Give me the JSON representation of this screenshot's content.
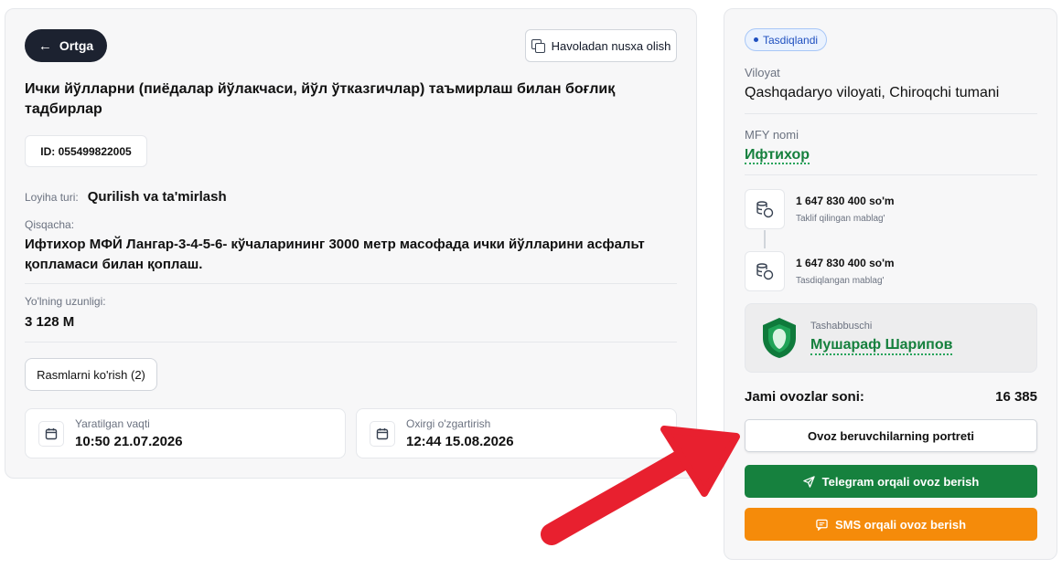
{
  "header": {
    "back_label": "Ortga",
    "copy_label": "Havoladan nusxa olish"
  },
  "project": {
    "title": "Ички йўлларни (пиёдалар йўлакчаси, йўл ўтказгичлар) таъмирлаш билан боғлиқ тадбирлар",
    "id": "ID: 055499822005",
    "type_label": "Loyiha turi:",
    "type_value": "Qurilish va ta'mirlash",
    "summary_label": "Qisqacha:",
    "summary_text": "Ифтихор МФЙ Лангар-3-4-5-6- кўчаларининг 3000 метр масофада ички йўлларини асфальт қопламаси билан қоплаш.",
    "length_label": "Yo'lning uzunligi:",
    "length_value": "3 128 М",
    "photos_label": "Rasmlarni ko'rish (2)",
    "created_label": "Yaratilgan vaqti",
    "created_value": "10:50 21.07.2026",
    "modified_label": "Oxirgi o'zgartirish",
    "modified_value": "12:44 15.08.2026"
  },
  "side": {
    "status": "Tasdiqlandi",
    "region_label": "Viloyat",
    "region_value": "Qashqadaryo viloyati, Chiroqchi tumani",
    "mfy_label": "MFY nomi",
    "mfy_value": "Ифтихор",
    "proposed_amount": "1 647 830 400 so'm",
    "proposed_label": "Taklif qilingan mablag'",
    "approved_amount": "1 647 830 400 so'm",
    "approved_label": "Tasdiqlangan mablag'",
    "initiator_label": "Tashabbuschi",
    "initiator_name": "Мушараф Шарипов",
    "votes_label": "Jami ovozlar soni:",
    "votes_value": "16 385",
    "portrait_btn": "Ovoz beruvchilarning portreti",
    "telegram_btn": "Telegram orqali ovoz berish",
    "sms_btn": "SMS orqali ovoz berish"
  },
  "colors": {
    "dark_button": "#1c2230",
    "green": "#16813e",
    "orange": "#f58b0a",
    "status_blue": "#1e4fbf",
    "arrow_red": "#e8202f"
  }
}
